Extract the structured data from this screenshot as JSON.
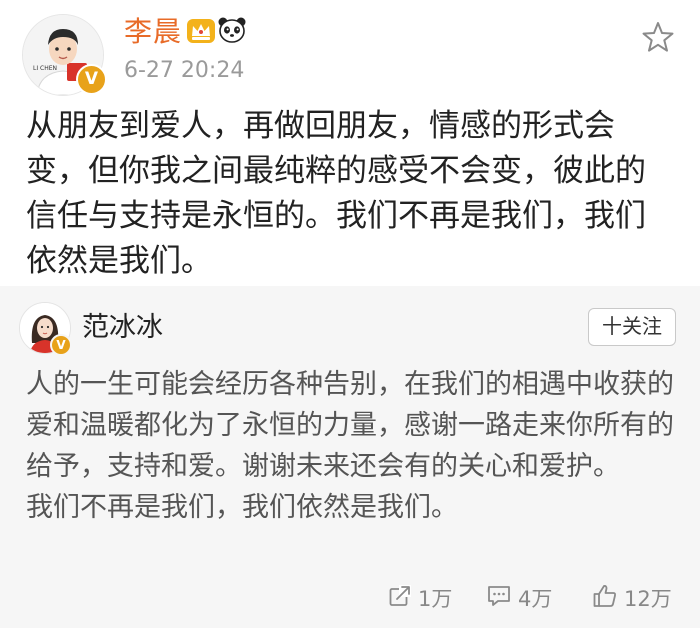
{
  "post": {
    "author": {
      "name": "李晨",
      "avatar_caption": "LI CHEN",
      "verified_mark": "V",
      "badges": [
        "crown-icon",
        "panda-icon"
      ]
    },
    "timestamp": "6-27 20:24",
    "text": "从朋友到爱人，再做回朋友，情感的形式会变，但你我之间最纯粹的感受不会变，彼此的信任与支持是永恒的。我们不再是我们，我们依然是我们。",
    "favorite_icon": "star-icon"
  },
  "repost": {
    "author": {
      "name": "范冰冰",
      "verified_mark": "V"
    },
    "follow_label": "十关注",
    "text_paragraph_1": "人的一生可能会经历各种告别，在我们的相遇中收获的爱和温暖都化为了永恒的力量，感谢一路走来你所有的给予，支持和爱。谢谢未来还会有的关心和爱护。",
    "text_paragraph_2": "我们不再是我们，我们依然是我们。",
    "actions": {
      "repost": {
        "icon": "share-icon",
        "count": "1万"
      },
      "comment": {
        "icon": "comment-icon",
        "count": "4万"
      },
      "like": {
        "icon": "thumbs-up-icon",
        "count": "12万"
      }
    }
  },
  "colors": {
    "author_name": "#e86b28",
    "verified_badge": "#e8a21a",
    "repost_background": "#f6f6f6",
    "meta_text": "#9a9a9a"
  }
}
